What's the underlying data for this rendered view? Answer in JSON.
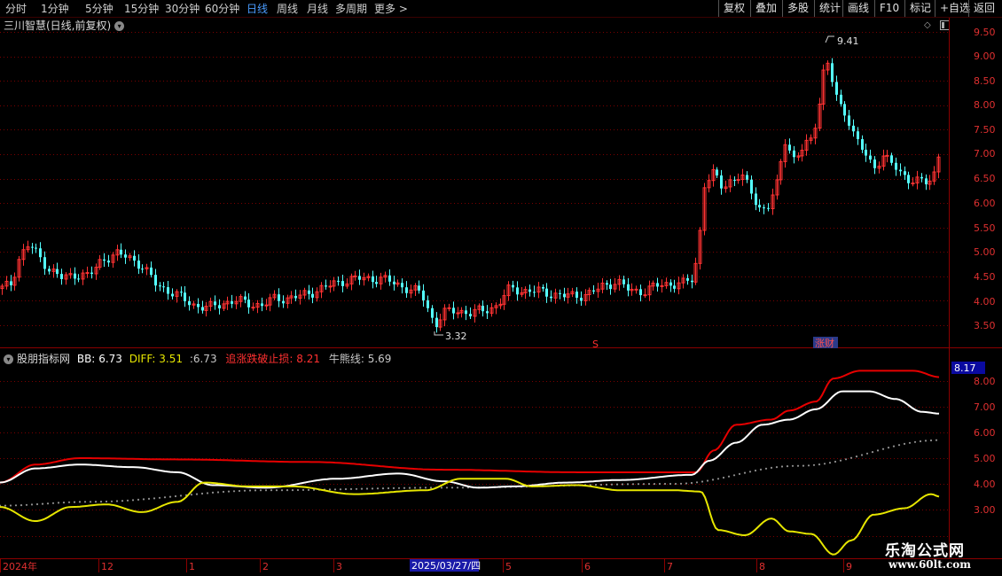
{
  "toolbar": {
    "periods": [
      "分时",
      "1分钟",
      "5分钟",
      "15分钟",
      "30分钟",
      "60分钟",
      "日线",
      "周线",
      "月线",
      "多周期",
      "更多"
    ],
    "active_period": "日线",
    "more_arrow": ">",
    "tools": [
      "复权",
      "叠加",
      "多股",
      "统计",
      "画线",
      "F10",
      "标记",
      "+自选",
      "返回"
    ]
  },
  "main_chart": {
    "title": "三川智慧(日线,前复权)",
    "high_label": "9.41",
    "low_label": "3.32",
    "marker_s": "S",
    "marker_zhangcai": "涨财",
    "price_axis": [
      "9.50",
      "9.00",
      "8.50",
      "8.00",
      "7.50",
      "7.00",
      "6.50",
      "6.00",
      "5.50",
      "5.00",
      "4.50",
      "4.00",
      "3.50"
    ]
  },
  "indicator": {
    "name": "股朋指标网",
    "bb_label": "BB:",
    "bb_value": "6.73",
    "diff_label": "DIFF:",
    "diff_value": "3.51",
    "extra_label": ":",
    "extra_value": "6.73",
    "stop_label": "追涨跌破止损:",
    "stop_value": "8.21",
    "bull_label": "牛熊线:",
    "bull_value": "5.69",
    "current_value_box": "8.17",
    "axis": [
      "8.00",
      "7.00",
      "6.00",
      "5.00",
      "4.00",
      "3.00"
    ]
  },
  "time_axis": {
    "labels": [
      "2024年",
      "12",
      "1",
      "2",
      "3",
      "5",
      "6",
      "7",
      "8",
      "9"
    ],
    "cursor_date": "2025/03/27/四"
  },
  "watermark": {
    "title": "乐淘公式网",
    "url": "www.60lt.com"
  },
  "colors": {
    "up": "#ff3232",
    "down": "#54ffff",
    "stop_line": "#e60000",
    "bb_line": "#ffffff",
    "diff_line": "#e6e600",
    "bull_line": "#909090",
    "active_period": "#4a9cff"
  }
}
